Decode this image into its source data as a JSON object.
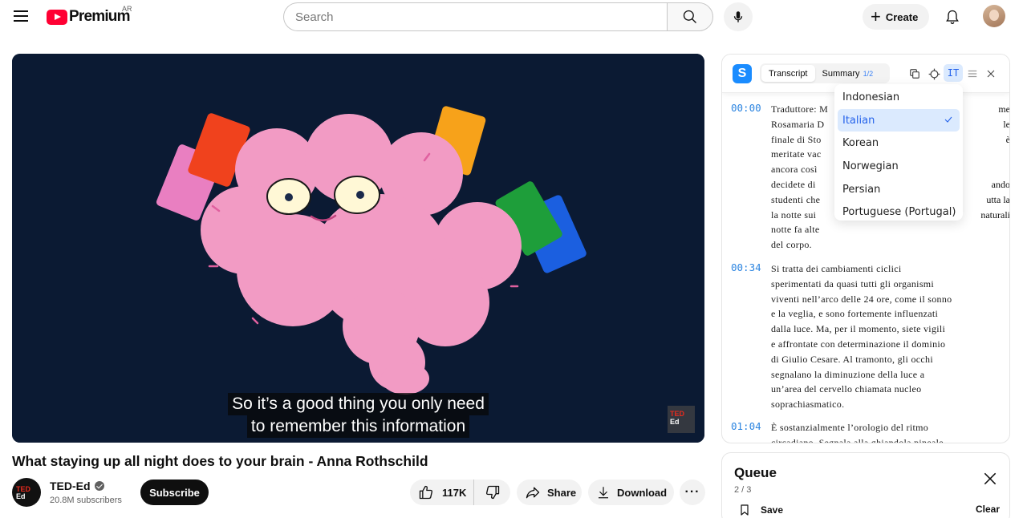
{
  "header": {
    "logo_text": "Premium",
    "country_code": "AR",
    "search_placeholder": "Search",
    "create_label": "Create"
  },
  "video": {
    "caption_line1": "So it’s a good thing you only need",
    "caption_line2": "to remember this information",
    "badge_line1": "TED",
    "badge_line2": "Ed",
    "title": "What staying up all night does to your brain - Anna Rothschild"
  },
  "channel": {
    "avatar_line1": "TED",
    "avatar_line2": "Ed",
    "name": "TED-Ed",
    "subscribers": "20.8M subscribers",
    "subscribe_label": "Subscribe"
  },
  "actions": {
    "likes": "117K",
    "share_label": "Share",
    "download_label": "Download",
    "more_label": "···"
  },
  "transcript": {
    "tab_transcript": "Transcript",
    "tab_summary": "Summary",
    "summary_fraction": "1/2",
    "language_code": "IT",
    "segments": [
      {
        "time": "00:00",
        "lines": [
          "Traduttore: M",
          "Rosamaria D",
          "finale di Sto",
          "meritate vac",
          "ancora così",
          "decidete di",
          "studenti che",
          "la notte sui",
          "notte fa alte",
          "del corpo."
        ],
        "right_fragments": [
          "me",
          "le",
          "è",
          "",
          "",
          "ando",
          "utta la",
          "naturali"
        ]
      },
      {
        "time": "00:34",
        "lines": [
          "Si tratta dei cambiamenti ciclici",
          "sperimentati da quasi tutti gli organismi",
          "viventi nell’arco delle 24 ore, come il sonno",
          "e la veglia, e sono fortemente influenzati",
          "dalla luce. Ma, per il momento, siete vigili",
          "e affrontate con determinazione il dominio",
          "di Giulio Cesare. Al tramonto, gli occhi",
          "segnalano la diminuzione della luce a",
          "un’area del cervello chiamata nucleo",
          "soprachiasmatico."
        ]
      },
      {
        "time": "01:04",
        "lines": [
          "È sostanzialmente l’orologio del ritmo",
          "circadiano. Segnala alla ghiandola pineale"
        ]
      }
    ]
  },
  "language_dropdown": {
    "items": [
      "Indonesian",
      "Italian",
      "Korean",
      "Norwegian",
      "Persian",
      "Portuguese (Portugal)"
    ],
    "selected": "Italian"
  },
  "queue": {
    "title": "Queue",
    "count": "2 / 3",
    "save_label": "Save",
    "clear_label": "Clear"
  },
  "colors": {
    "youtube_red": "#ff0033",
    "accent_blue": "#2b84e0",
    "video_bg": "#0b1a33",
    "brain_pink": "#f29bc4"
  }
}
